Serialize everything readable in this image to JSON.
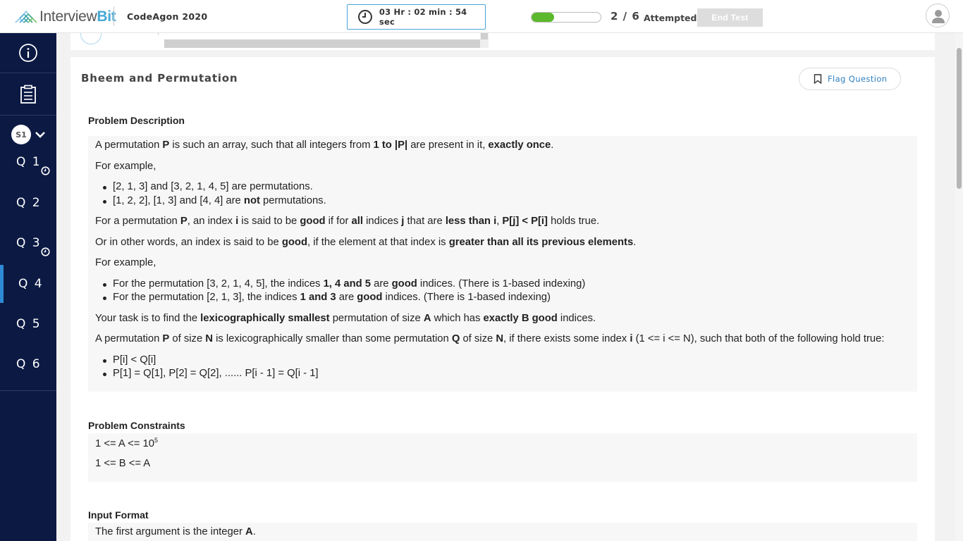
{
  "header": {
    "logo_prefix": "Interview",
    "logo_suffix": "Bit",
    "contest_name": "CodeAgon 2020",
    "timer": "03 Hr : 02 min : 54 sec",
    "attempted_count": "2 / 6",
    "attempted_fraction": 0.33,
    "attempted_label": "Attempted",
    "end_test_label": "End Test"
  },
  "sidebar": {
    "section": "S1",
    "questions": [
      {
        "label": "Q 1",
        "flagged": true,
        "active": false
      },
      {
        "label": "Q 2",
        "flagged": false,
        "active": false
      },
      {
        "label": "Q 3",
        "flagged": true,
        "active": false
      },
      {
        "label": "Q 4",
        "flagged": false,
        "active": true
      },
      {
        "label": "Q 5",
        "flagged": false,
        "active": false
      },
      {
        "label": "Q 6",
        "flagged": false,
        "active": false
      }
    ]
  },
  "problem": {
    "title": "Bheem and Permutation",
    "flag_label": "Flag Question",
    "description_heading": "Problem Description",
    "constraints_heading": "Problem Constraints",
    "input_heading": "Input Format",
    "d1": [
      "A permutation ",
      "P",
      " is such an array, such that all integers from ",
      "1 to |P|",
      " are present in it, ",
      "exactly once",
      "."
    ],
    "d2": "For example,",
    "b1": "[2, 1, 3] and [3, 2, 1, 4, 5] are permutations.",
    "b2": [
      "[1, 2, 2], [1, 3] and [4, 4] are ",
      "not",
      " permutations."
    ],
    "d3": [
      "For a permutation ",
      "P",
      ", an index ",
      "i",
      " is said to be ",
      "good",
      " if for ",
      "all",
      " indices ",
      "j",
      " that are ",
      "less than i",
      ", ",
      "P[j] < P[i]",
      " holds true."
    ],
    "d4": [
      "Or in other words, an index is said to be ",
      "good",
      ", if the element at that index is ",
      "greater than all its previous elements",
      "."
    ],
    "d5": "For example,",
    "b3": [
      "For the permutation [3, 2, 1, 4, 5], the indices ",
      "1, 4 and 5",
      " are ",
      "good",
      " indices. (There is 1-based indexing)"
    ],
    "b4": [
      "For the permutation [2, 1, 3], the indices ",
      "1 and 3",
      " are ",
      "good",
      " indices. (There is 1-based indexing)"
    ],
    "d6": [
      "Your task is to find the ",
      "lexicographically smallest",
      " permutation of size ",
      "A",
      " which has ",
      "exactly B good",
      " indices."
    ],
    "d7": [
      "A permutation ",
      "P",
      " of size ",
      "N",
      " is lexicographically smaller than some permutation ",
      "Q",
      " of size ",
      "N",
      ", if there exists some index ",
      "i",
      " (1 <= i <= N), such that both of the following hold true:"
    ],
    "b5": "P[i] < Q[i]",
    "b6": "P[1] = Q[1], P[2] = Q[2], ...... P[i - 1] = Q[i - 1]",
    "c1_base": "1 <= A <= 10",
    "c1_exp": "5",
    "c2": "1 <= B <= A",
    "i1": [
      "The first argument is the integer ",
      "A",
      "."
    ]
  },
  "colors": {
    "sidebar_bg": "#0b1943",
    "accent": "#2f8ad5",
    "progress": "#5cb82c"
  }
}
